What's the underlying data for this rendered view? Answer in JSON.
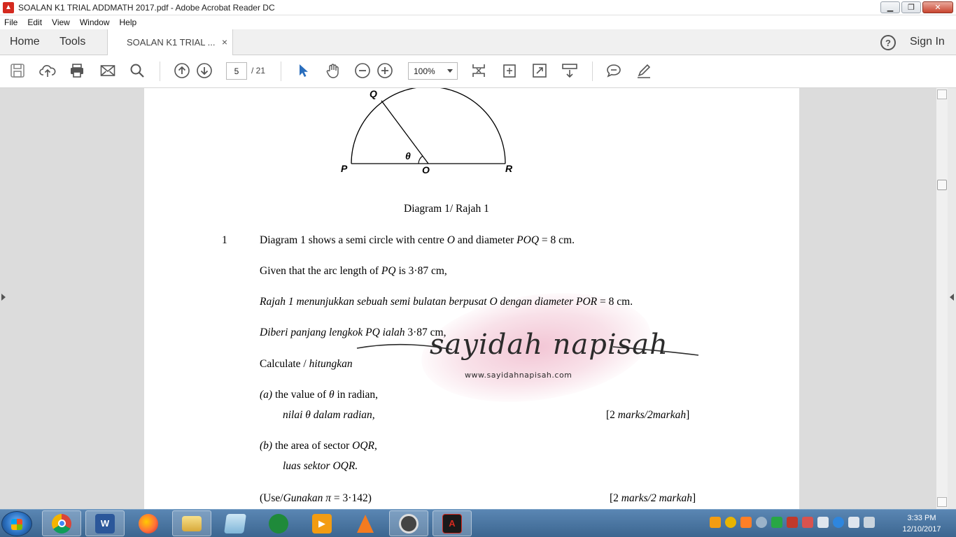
{
  "window": {
    "title": "SOALAN K1 TRIAL ADDMATH 2017.pdf - Adobe Acrobat Reader DC",
    "app_icon": "pdf-icon",
    "controls": [
      "minimize",
      "restore",
      "close"
    ]
  },
  "menu": [
    "File",
    "Edit",
    "View",
    "Window",
    "Help"
  ],
  "tabs": {
    "home": "Home",
    "tools": "Tools",
    "document": "SOALAN K1 TRIAL ...",
    "close": "×",
    "help": "?",
    "sign_in": "Sign In"
  },
  "toolbar": {
    "icons": [
      "save-icon",
      "upload-icon",
      "print-icon",
      "email-icon",
      "search-icon",
      "previous-page-icon",
      "next-page-icon",
      "select-cursor-icon",
      "hand-tool-icon",
      "zoom-out-icon",
      "zoom-in-icon",
      "fit-page-icon",
      "rotate-icon",
      "full-screen-icon",
      "read-mode-icon",
      "comment-icon",
      "sign-icon"
    ],
    "page_current": "5",
    "page_total": "/ 21",
    "zoom": "100%"
  },
  "document": {
    "diagram": {
      "labels": {
        "q": "Q",
        "p": "P",
        "o": "O",
        "r": "R",
        "theta": "θ"
      },
      "caption": "Diagram 1/ Rajah 1"
    },
    "question_number": "1",
    "lines": {
      "l1_a": "Diagram 1 shows a semi circle with centre ",
      "l1_b": "O",
      "l1_c": " and diameter ",
      "l1_d": "POQ",
      "l1_e": " = 8 cm.",
      "l2_a": "Given that the arc length of ",
      "l2_b": "PQ",
      "l2_c": " is 3·87 cm,",
      "l3_a": "Rajah 1 menunjukkan sebuah semi bulatan berpusat O dengan diameter POR",
      "l3_b": " = 8 cm.",
      "l4_a": "Diberi panjang lengkok PQ ialah",
      "l4_b": " 3·87 cm,",
      "l5_a": "Calculate / ",
      "l5_b": "hitungkan",
      "a_label": "(a)",
      "a_text_a": " the value of ",
      "a_text_b": "θ",
      "a_text_c": " in radian,",
      "a_malay": "nilai θ dalam radian,",
      "a_marks_a": "[2 ",
      "a_marks_b": "marks/2markah",
      "a_marks_c": "]",
      "b_label": "(b)",
      "b_text_a": " the area of sector ",
      "b_text_b": "OQR",
      "b_text_c": ",",
      "b_malay": "luas sektor OQR.",
      "use_a": "(Use/",
      "use_b": "Gunakan",
      "use_c": " π",
      "use_d": " = 3·142)",
      "b_marks_a": "[2 ",
      "b_marks_b": "marks/2 markah",
      "b_marks_c": "]"
    },
    "watermark": {
      "name": "sayidah napisah",
      "url": "www.sayidahnapisah.com"
    }
  },
  "taskbar": {
    "apps": [
      "chrome-icon",
      "word-icon",
      "firefox-icon",
      "file-explorer-icon",
      "notepad-icon",
      "network-app-icon",
      "media-player-icon",
      "vlc-icon",
      "search-app-icon",
      "acrobat-icon"
    ],
    "word_letter": "W",
    "clock_time": "3:33 PM",
    "clock_date": "12/10/2017"
  },
  "colors": {
    "acrobat_red": "#d42a1f",
    "taskbar": "#4a76a3",
    "watermark_pink": "#e896b2"
  }
}
